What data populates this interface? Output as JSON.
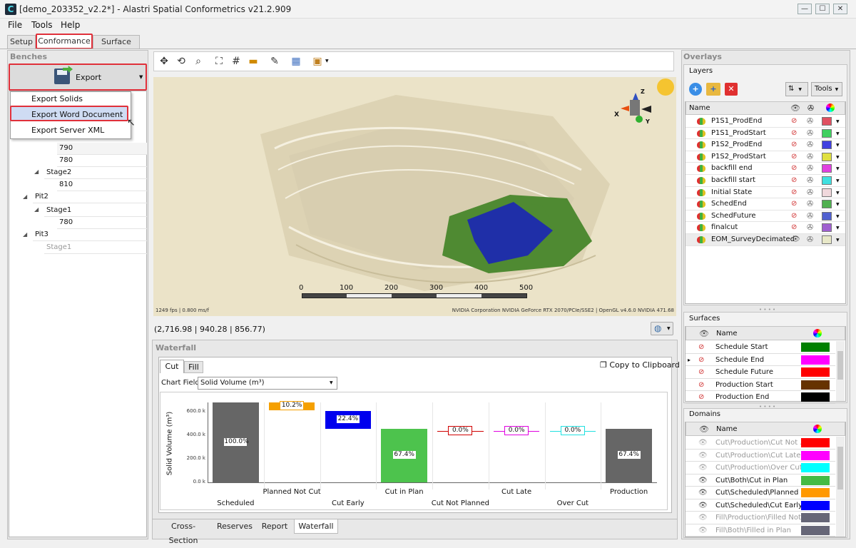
{
  "window": {
    "title": "[demo_203352_v2.2*] - Alastri Spatial Conformetrics v21.2.909",
    "app_icon": "C",
    "minimize": "—",
    "maximize": "☐",
    "close": "✕"
  },
  "menu": [
    "File",
    "Tools",
    "Help"
  ],
  "top_tabs": [
    "Setup",
    "Conformance",
    "Surface Lab"
  ],
  "benches": {
    "title": "Benches",
    "export_label": "Export",
    "dropdown": [
      "Export Solids",
      "Export Word Document",
      "Export Server XML"
    ],
    "tree": [
      "790",
      "780",
      "Stage2",
      "810",
      "Pit2",
      "Stage1",
      "780",
      "Pit3",
      "Stage1"
    ]
  },
  "viewport": {
    "fps": "1249 fps | 0.800 ms/f",
    "gpu": "NVIDIA Corporation NVIDIA GeForce RTX 2070/PCIe/SSE2 | OpenGL v4.6.0 NVIDIA 471.68",
    "scale_labels": [
      "0",
      "100",
      "200",
      "300",
      "400",
      "500"
    ],
    "coords": "(2,716.98 | 940.28 | 856.77)",
    "axis_x": "X",
    "axis_y": "Y",
    "axis_z": "Z"
  },
  "waterfall": {
    "title": "Waterfall",
    "tabs": [
      "Cut",
      "Fill"
    ],
    "copy_label": "Copy to Clipboard",
    "chart_field_label": "Chart Field",
    "chart_field_value": "Solid Volume (m³)"
  },
  "chart_data": {
    "type": "bar",
    "subtype": "waterfall",
    "ylabel": "Solid Volume (m³)",
    "ylim": [
      0,
      680
    ],
    "yticks": [
      "0.0 k",
      "200.0 k",
      "400.0 k",
      "600.0 k"
    ],
    "categories": [
      "Scheduled",
      "Planned Not Cut",
      "Cut Early",
      "Cut in Plan",
      "Cut Not Planned",
      "Cut Late",
      "Over Cut",
      "Production"
    ],
    "start": [
      0,
      612,
      458,
      0,
      0,
      0,
      0,
      0
    ],
    "end": [
      680,
      683,
      610,
      458,
      0,
      0,
      0,
      458
    ],
    "labels": [
      "100.0%",
      "10.2%",
      "22.4%",
      "67.4%",
      "0.0%",
      "0.0%",
      "0.0%",
      "67.4%"
    ],
    "colors": [
      "#666666",
      "#f5a000",
      "#0000ee",
      "#4dc34d",
      "#d00000",
      "#e000e0",
      "#20e0e0",
      "#666666"
    ]
  },
  "bottom_tabs": [
    "Cross-Section",
    "Reserves",
    "Report",
    "Waterfall"
  ],
  "overlays": {
    "title": "Overlays",
    "layers_title": "Layers",
    "tools_label": "Tools",
    "name_col": "Name",
    "layers": [
      {
        "name": "P1S1_ProdEnd",
        "color": "#e05060",
        "visible": false
      },
      {
        "name": "P1S1_ProdStart",
        "color": "#40d060",
        "visible": false
      },
      {
        "name": "P1S2_ProdEnd",
        "color": "#4040e0",
        "visible": false
      },
      {
        "name": "P1S2_ProdStart",
        "color": "#e0e040",
        "visible": false
      },
      {
        "name": "backfill end",
        "color": "#e040e0",
        "visible": false
      },
      {
        "name": "backfill start",
        "color": "#40e0e0",
        "visible": false
      },
      {
        "name": "Initial State",
        "color": "#f0d8dc",
        "visible": false
      },
      {
        "name": "SchedEnd",
        "color": "#50b050",
        "visible": false
      },
      {
        "name": "SchedFuture",
        "color": "#5060d0",
        "visible": false
      },
      {
        "name": "finalcut",
        "color": "#a060d0",
        "visible": false
      },
      {
        "name": "EOM_SurveyDecimated",
        "color": "#e8e8c8",
        "visible": true
      }
    ]
  },
  "surfaces": {
    "title": "Surfaces",
    "name_col": "Name",
    "items": [
      {
        "name": "Schedule Start",
        "color": "#008000"
      },
      {
        "name": "Schedule End",
        "color": "#ff00ff"
      },
      {
        "name": "Schedule Future",
        "color": "#ff0000"
      },
      {
        "name": "Production Start",
        "color": "#663300"
      },
      {
        "name": "Production End",
        "color": "#000000"
      }
    ]
  },
  "domains": {
    "title": "Domains",
    "name_col": "Name",
    "items": [
      {
        "name": "Cut\\Production\\Cut Not ...",
        "color": "#ff0000",
        "on": false
      },
      {
        "name": "Cut\\Production\\Cut Late",
        "color": "#ff00ff",
        "on": false
      },
      {
        "name": "Cut\\Production\\Over Cut",
        "color": "#00ffff",
        "on": false
      },
      {
        "name": "Cut\\Both\\Cut in Plan",
        "color": "#44bb44",
        "on": true
      },
      {
        "name": "Cut\\Scheduled\\Planned ...",
        "color": "#ff9900",
        "on": true
      },
      {
        "name": "Cut\\Scheduled\\Cut Early",
        "color": "#0000ff",
        "on": true
      },
      {
        "name": "Fill\\Production\\Filled Not...",
        "color": "#666677",
        "on": false
      },
      {
        "name": "Fill\\Both\\Filled in Plan",
        "color": "#666677",
        "on": false
      }
    ]
  }
}
